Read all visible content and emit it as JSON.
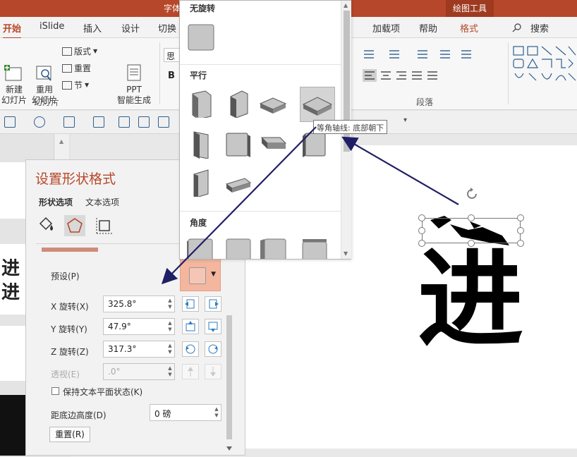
{
  "window": {
    "doc_title_fragment": "字体",
    "context_tab": "绘图工具"
  },
  "tabs": [
    {
      "label": "开始",
      "active": true
    },
    {
      "label": "iSlide"
    },
    {
      "label": "插入"
    },
    {
      "label": "设计"
    },
    {
      "label": "切换"
    },
    {
      "label": "加载项"
    },
    {
      "label": "帮助"
    },
    {
      "label": "格式"
    }
  ],
  "search": {
    "label": "搜索"
  },
  "ribbon": {
    "new_slide": "新建\n幻灯片",
    "reuse_slide": "重用\n幻灯片",
    "layout": "版式",
    "reset": "重置",
    "section": "节",
    "ppt_ai": "PPT\n智能生成",
    "slides_group": "幻灯片",
    "paragraph_group": "段落",
    "font_box": "思源",
    "bold": "B"
  },
  "format_pane": {
    "title": "设置形状格式",
    "tab_shape": "形状选项",
    "tab_text": "文本选项",
    "preset_label": "预设(P)",
    "x_label": "X 旋转(X)",
    "x_value": "325.8°",
    "y_label": "Y 旋转(Y)",
    "y_value": "47.9°",
    "z_label": "Z 旋转(Z)",
    "z_value": "317.3°",
    "persp_label": "透视(E)",
    "persp_value": ".0°",
    "keep_flat": "保持文本平面状态(K)",
    "distance_label": "距底边高度(D)",
    "distance_value": "0 磅",
    "reset_btn": "重置(R)"
  },
  "gallery": {
    "no_rotation": "无旋转",
    "parallel": "平行",
    "angle": "角度",
    "tooltip": "等角轴线: 底部朝下"
  },
  "slide": {
    "glyph": "进"
  },
  "colors": {
    "accent": "#b7472a",
    "arrow": "#1f1f66"
  }
}
